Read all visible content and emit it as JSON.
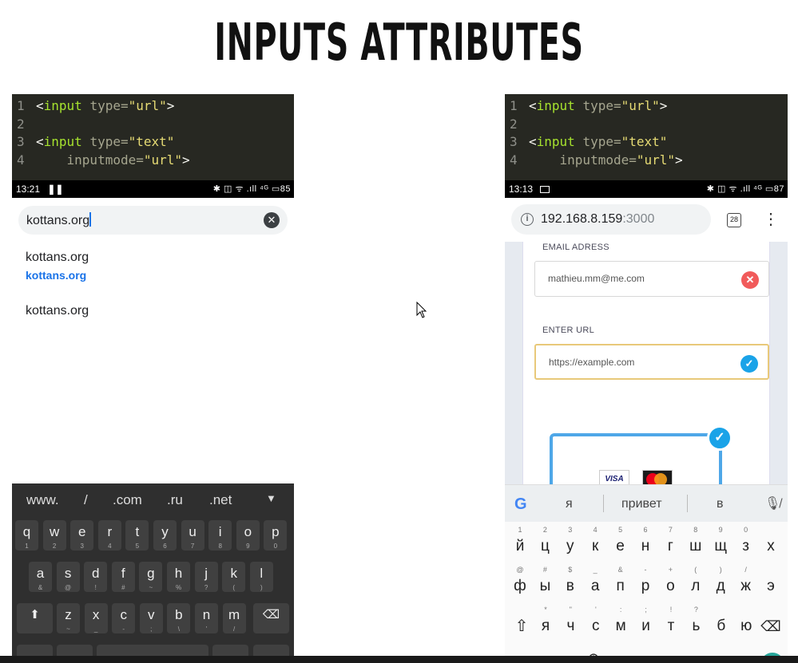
{
  "title": "INPUTS ATTRIBUTES",
  "code": {
    "line_numbers": [
      "1",
      "2",
      "3",
      "4"
    ],
    "tag": "input",
    "attr_type": "type=",
    "val_url": "\"url\"",
    "val_text": "\"text\"",
    "attr_inputmode": "inputmode=",
    "lt": "<",
    "gt": ">"
  },
  "left": {
    "status": {
      "time": "13:21",
      "icons": "✱ ◫ ᯤ .ıll ⁴ᴳ ▭85",
      "battery": "85"
    },
    "search": {
      "value": "kottans.org"
    },
    "suggestions": [
      {
        "title": "kottans.org",
        "url": "kottans.org"
      },
      {
        "title": "kottans.org"
      }
    ],
    "keyboard": {
      "shortcuts": [
        "www.",
        "/",
        ".com",
        ".ru",
        ".net"
      ],
      "row1": [
        [
          "q",
          "1"
        ],
        [
          "w",
          "2"
        ],
        [
          "e",
          "3"
        ],
        [
          "r",
          "4"
        ],
        [
          "t",
          "5"
        ],
        [
          "y",
          "6"
        ],
        [
          "u",
          "7"
        ],
        [
          "i",
          "8"
        ],
        [
          "o",
          "9"
        ],
        [
          "p",
          "0"
        ]
      ],
      "row2": [
        [
          "a",
          "&"
        ],
        [
          "s",
          "@"
        ],
        [
          "d",
          "!"
        ],
        [
          "f",
          "#"
        ],
        [
          "g",
          "~"
        ],
        [
          "h",
          "%"
        ],
        [
          "j",
          "?"
        ],
        [
          "k",
          "("
        ],
        [
          "l",
          ")"
        ]
      ],
      "row3": [
        [
          "z",
          "~"
        ],
        [
          "x",
          "_"
        ],
        [
          "c",
          "-"
        ],
        [
          "v",
          ";"
        ],
        [
          "b",
          "\\"
        ],
        [
          "n",
          "'"
        ],
        [
          "m",
          "/"
        ]
      ]
    }
  },
  "right": {
    "status": {
      "time": "13:13",
      "icons": "✱ ◫ ᯤ .ıll ⁴ᴳ ▭87",
      "battery": "87"
    },
    "address": {
      "host": "192.168.8.159",
      "port": ":3000",
      "tab_count": "28"
    },
    "form": {
      "email_label": "EMAIL ADRESS",
      "email_value": "mathieu.mm@me.com",
      "url_label": "ENTER URL",
      "url_value": "https://example.com",
      "visa": "VISA"
    },
    "keyboard": {
      "suggestions": [
        "я",
        "привет",
        "в"
      ],
      "row1": [
        [
          "й",
          "1"
        ],
        [
          "ц",
          "2"
        ],
        [
          "у",
          "3"
        ],
        [
          "к",
          "4"
        ],
        [
          "е",
          "5"
        ],
        [
          "н",
          "6"
        ],
        [
          "г",
          "7"
        ],
        [
          "ш",
          "8"
        ],
        [
          "щ",
          "9"
        ],
        [
          "з",
          "0"
        ],
        [
          "х",
          ""
        ]
      ],
      "row2": [
        [
          "ф",
          "@"
        ],
        [
          "ы",
          "#"
        ],
        [
          "в",
          "$"
        ],
        [
          "а",
          "_"
        ],
        [
          "п",
          "&"
        ],
        [
          "р",
          "-"
        ],
        [
          "о",
          "+"
        ],
        [
          "л",
          "("
        ],
        [
          "д",
          ")"
        ],
        [
          "ж",
          "/"
        ],
        [
          "э",
          ""
        ]
      ],
      "row3": [
        [
          "я",
          "*"
        ],
        [
          "ч",
          "\""
        ],
        [
          "с",
          "'"
        ],
        [
          "м",
          ":"
        ],
        [
          "и",
          ";"
        ],
        [
          "т",
          "!"
        ],
        [
          "ь",
          "?"
        ],
        [
          "б",
          ""
        ],
        [
          "ю",
          ""
        ]
      ]
    }
  },
  "colors": {
    "code_bg": "#272822",
    "keyword": "#a6e22e",
    "string": "#e6db74",
    "link": "#1a73e8",
    "error": "#f15b5b",
    "success": "#1aa3e8"
  }
}
